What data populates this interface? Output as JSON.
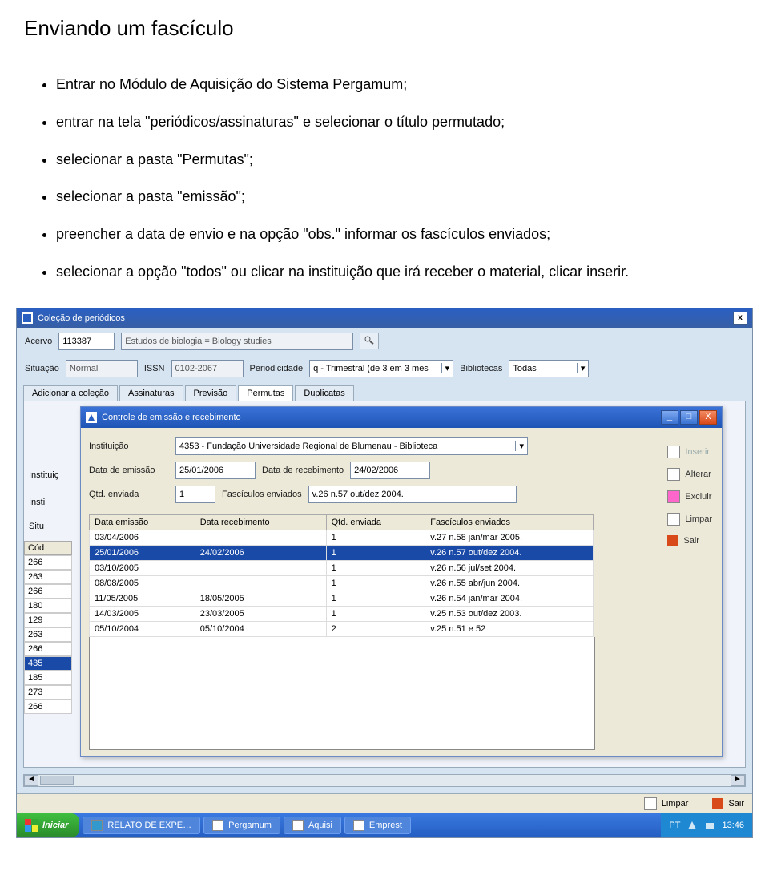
{
  "doc": {
    "title": "Enviando um fascículo",
    "bullets": [
      "Entrar no Módulo de Aquisição do Sistema Pergamum;",
      "entrar na tela \"periódicos/assinaturas\" e selecionar o título permutado;",
      "selecionar a pasta \"Permutas\";",
      "selecionar a pasta \"emissão\";",
      "preencher a data de envio e na opção \"obs.\" informar os fascículos enviados;",
      "selecionar a opção \"todos\" ou clicar na instituição que irá receber o material, clicar inserir."
    ]
  },
  "outer": {
    "title": "Coleção de periódicos",
    "close": "x",
    "fields": {
      "acervo_label": "Acervo",
      "acervo_value": "113387",
      "titulo_value": "Estudos de biologia = Biology studies",
      "situacao_label": "Situação",
      "situacao_value": "Normal",
      "issn_label": "ISSN",
      "issn_value": "0102-2067",
      "period_label": "Periodicidade",
      "period_value": "q - Trimestral (de 3 em 3 mes",
      "bib_label": "Bibliotecas",
      "bib_value": "Todas"
    },
    "tabs": [
      "Adicionar a coleção",
      "Assinaturas",
      "Previsão",
      "Permutas",
      "Duplicatas"
    ],
    "active_tab": 3,
    "left_labels": {
      "instituicao": "Instituiç",
      "insti": "Insti",
      "situ": "Situ",
      "cod_header": "Cód"
    },
    "left_codes": [
      "266",
      "263",
      "266",
      "180",
      "129",
      "263",
      "266",
      "435",
      "185",
      "273",
      "266"
    ],
    "left_selected": "435",
    "scroll_left": "◄",
    "scroll_right": "►",
    "status_limpar": "Limpar",
    "status_sair": "Sair"
  },
  "dialog": {
    "title": "Controle de emissão e recebimento",
    "winbtns": {
      "min": "_",
      "max": "□",
      "close": "X"
    },
    "fields": {
      "inst_label": "Instituição",
      "inst_value": "4353 - Fundação Universidade Regional de Blumenau - Biblioteca",
      "emissao_label": "Data de emissão",
      "emissao_value": "25/01/2006",
      "receb_label": "Data de recebimento",
      "receb_value": "24/02/2006",
      "qtd_label": "Qtd. enviada",
      "qtd_value": "1",
      "fasc_label": "Fascículos enviados",
      "fasc_value": "v.26 n.57 out/dez 2004."
    },
    "actions": {
      "inserir": "Inserir",
      "alterar": "Alterar",
      "excluir": "Excluir",
      "limpar": "Limpar",
      "sair": "Sair"
    },
    "table": {
      "headers": [
        "Data emissão",
        "Data recebimento",
        "Qtd. enviada",
        "Fascículos enviados"
      ],
      "rows": [
        {
          "c": [
            "03/04/2006",
            "",
            "1",
            "v.27 n.58 jan/mar 2005."
          ],
          "sel": false
        },
        {
          "c": [
            "25/01/2006",
            "24/02/2006",
            "1",
            "v.26 n.57 out/dez 2004."
          ],
          "sel": true
        },
        {
          "c": [
            "03/10/2005",
            "",
            "1",
            "v.26 n.56 jul/set 2004."
          ],
          "sel": false
        },
        {
          "c": [
            "08/08/2005",
            "",
            "1",
            "v.26 n.55 abr/jun 2004."
          ],
          "sel": false
        },
        {
          "c": [
            "11/05/2005",
            "18/05/2005",
            "1",
            "v.26 n.54 jan/mar 2004."
          ],
          "sel": false
        },
        {
          "c": [
            "14/03/2005",
            "23/03/2005",
            "1",
            "v.25 n.53 out/dez 2003."
          ],
          "sel": false
        },
        {
          "c": [
            "05/10/2004",
            "05/10/2004",
            "2",
            "v.25 n.51 e 52"
          ],
          "sel": false
        }
      ]
    }
  },
  "taskbar": {
    "start": "Iniciar",
    "buttons": [
      "RELATO DE EXPE…",
      "Pergamum",
      "Aquisi",
      "Emprest"
    ],
    "lang": "PT",
    "clock": "13:46"
  }
}
